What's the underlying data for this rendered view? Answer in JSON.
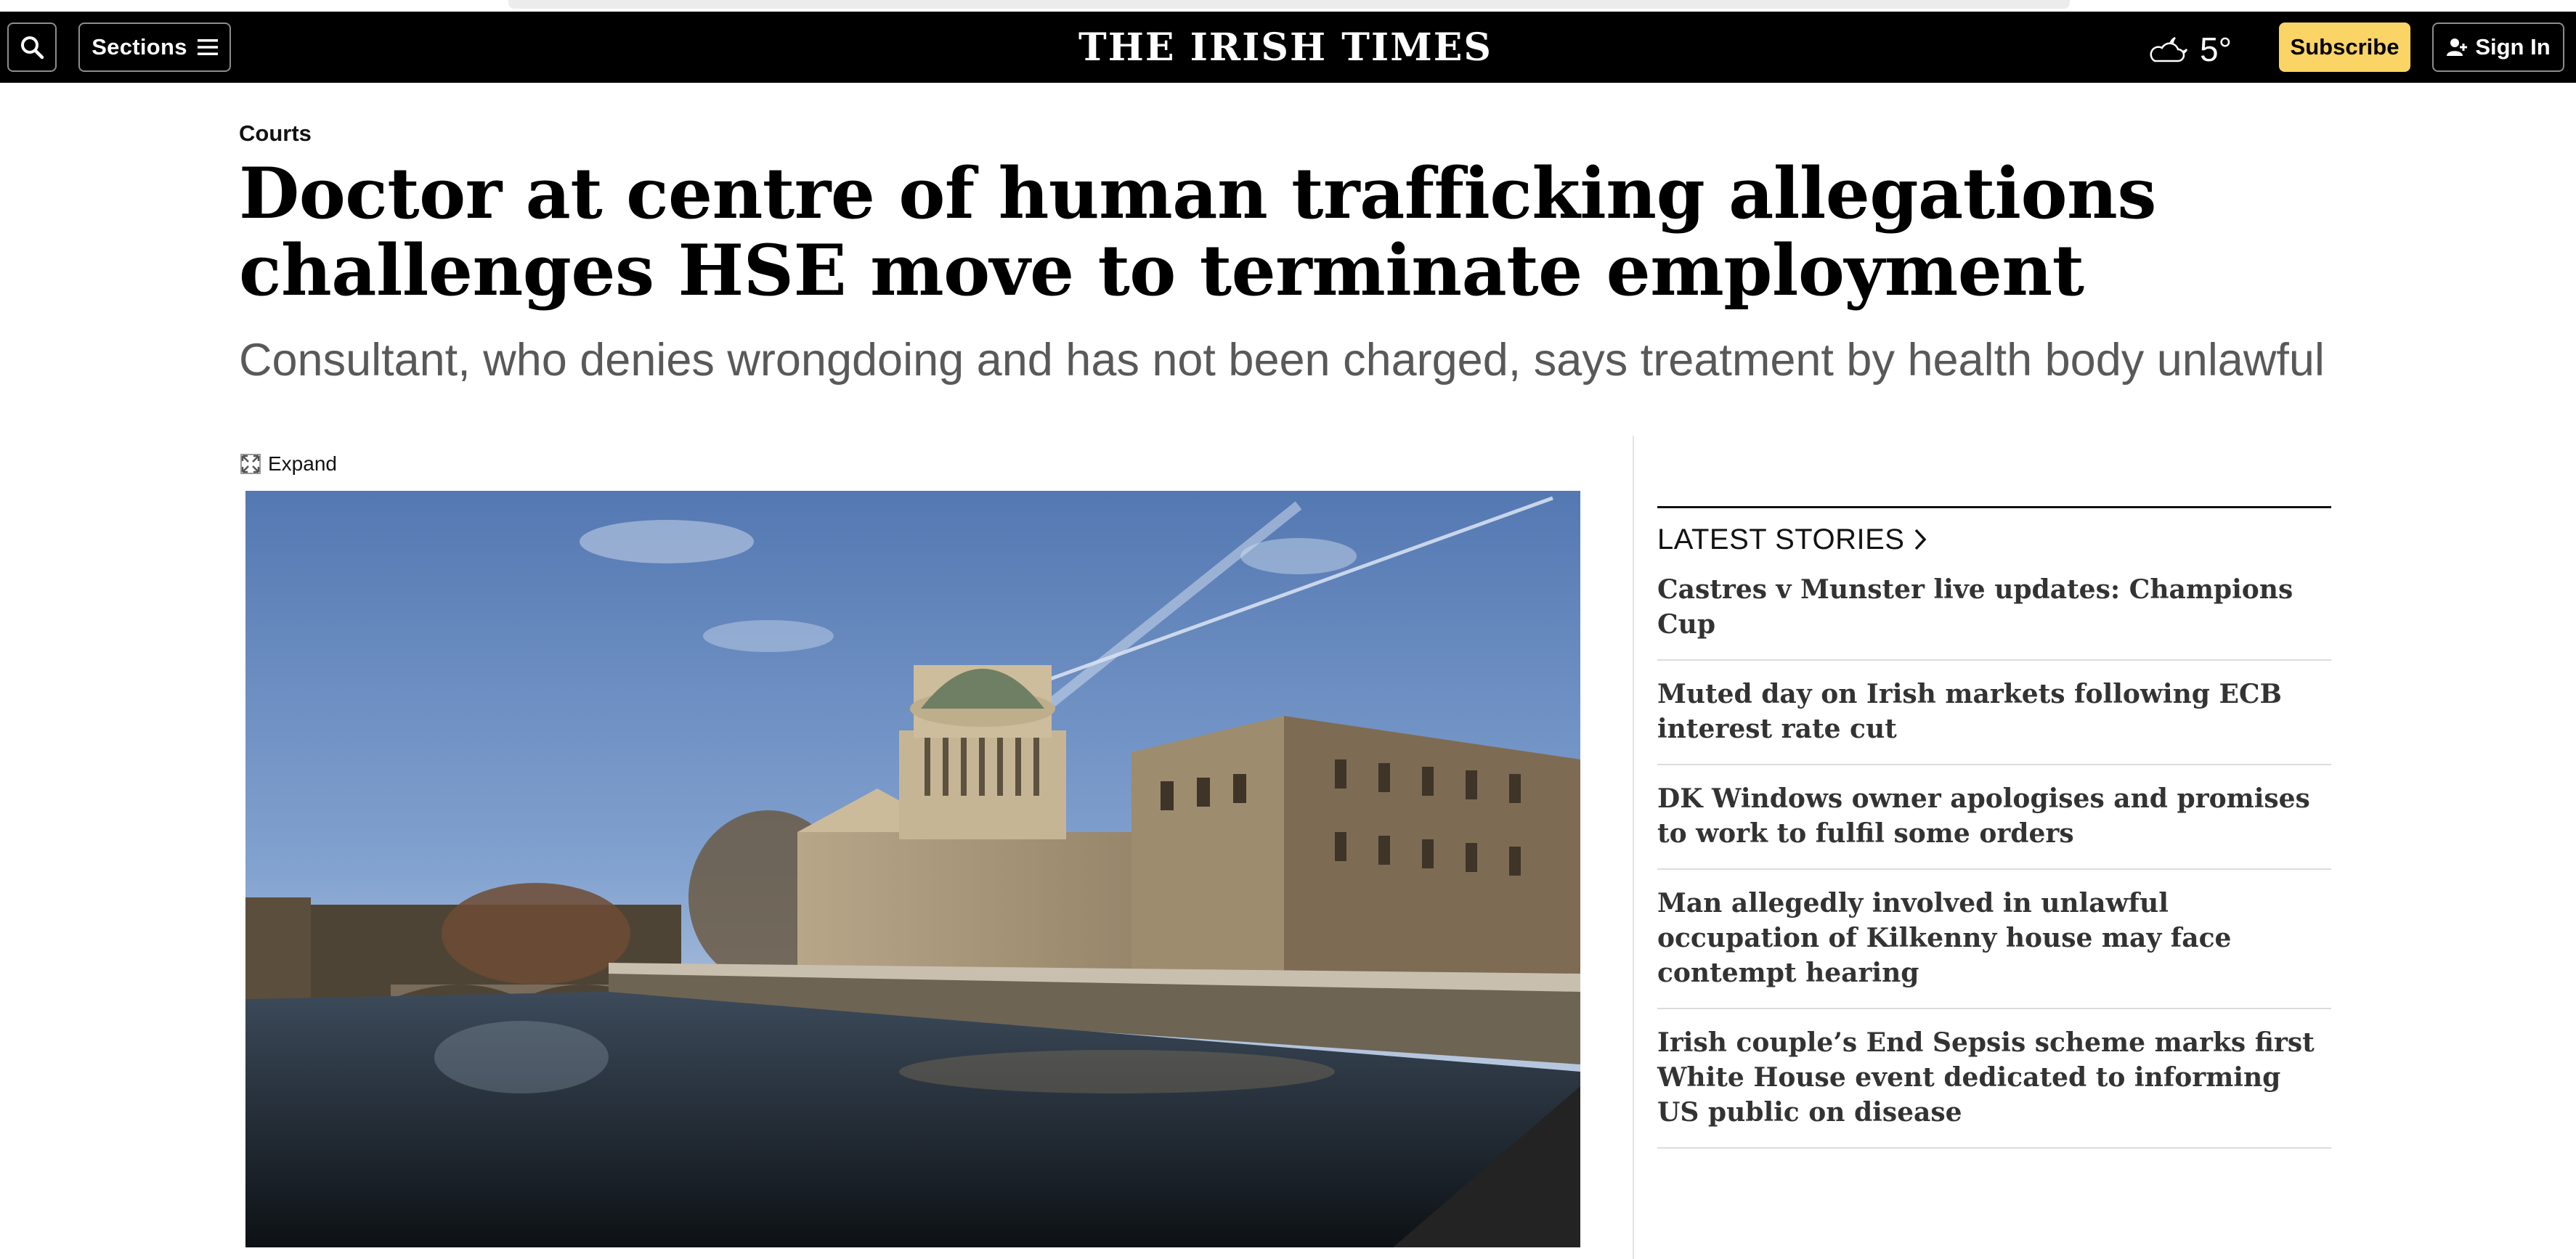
{
  "header": {
    "search_icon": "search-icon",
    "sections_label": "Sections",
    "sections_icon": "hamburger-icon",
    "masthead": "THE IRISH TIMES",
    "weather_icon": "cloud-moon-icon",
    "temperature": "5°",
    "subscribe_label": "Subscribe",
    "signin_label": "Sign In",
    "signin_icon": "user-icon",
    "subscribe_color": "#fbd466"
  },
  "article": {
    "category": "Courts",
    "headline": "Doctor at centre of human trafficking allegations challenges HSE move to terminate employment",
    "standfirst": "Consultant, who denies wrongdoing and has not been charged, says treatment by health body unlawful",
    "expand_label": "Expand",
    "expand_icon": "expand-icon",
    "image": "Four Courts building beside the River Liffey, Dublin"
  },
  "sidebar": {
    "latest_title": "LATEST STORIES",
    "latest_icon": "chevron-right-icon",
    "stories": [
      "Castres v Munster live updates: Champions Cup",
      "Muted day on Irish markets following ECB interest rate cut",
      "DK Windows owner apologises and promises to work to fulfil some orders",
      "Man allegedly involved in unlawful occupation of Kilkenny house may face contempt hearing",
      "Irish couple’s End Sepsis scheme marks first White House event dedicated to informing US public on disease"
    ]
  }
}
